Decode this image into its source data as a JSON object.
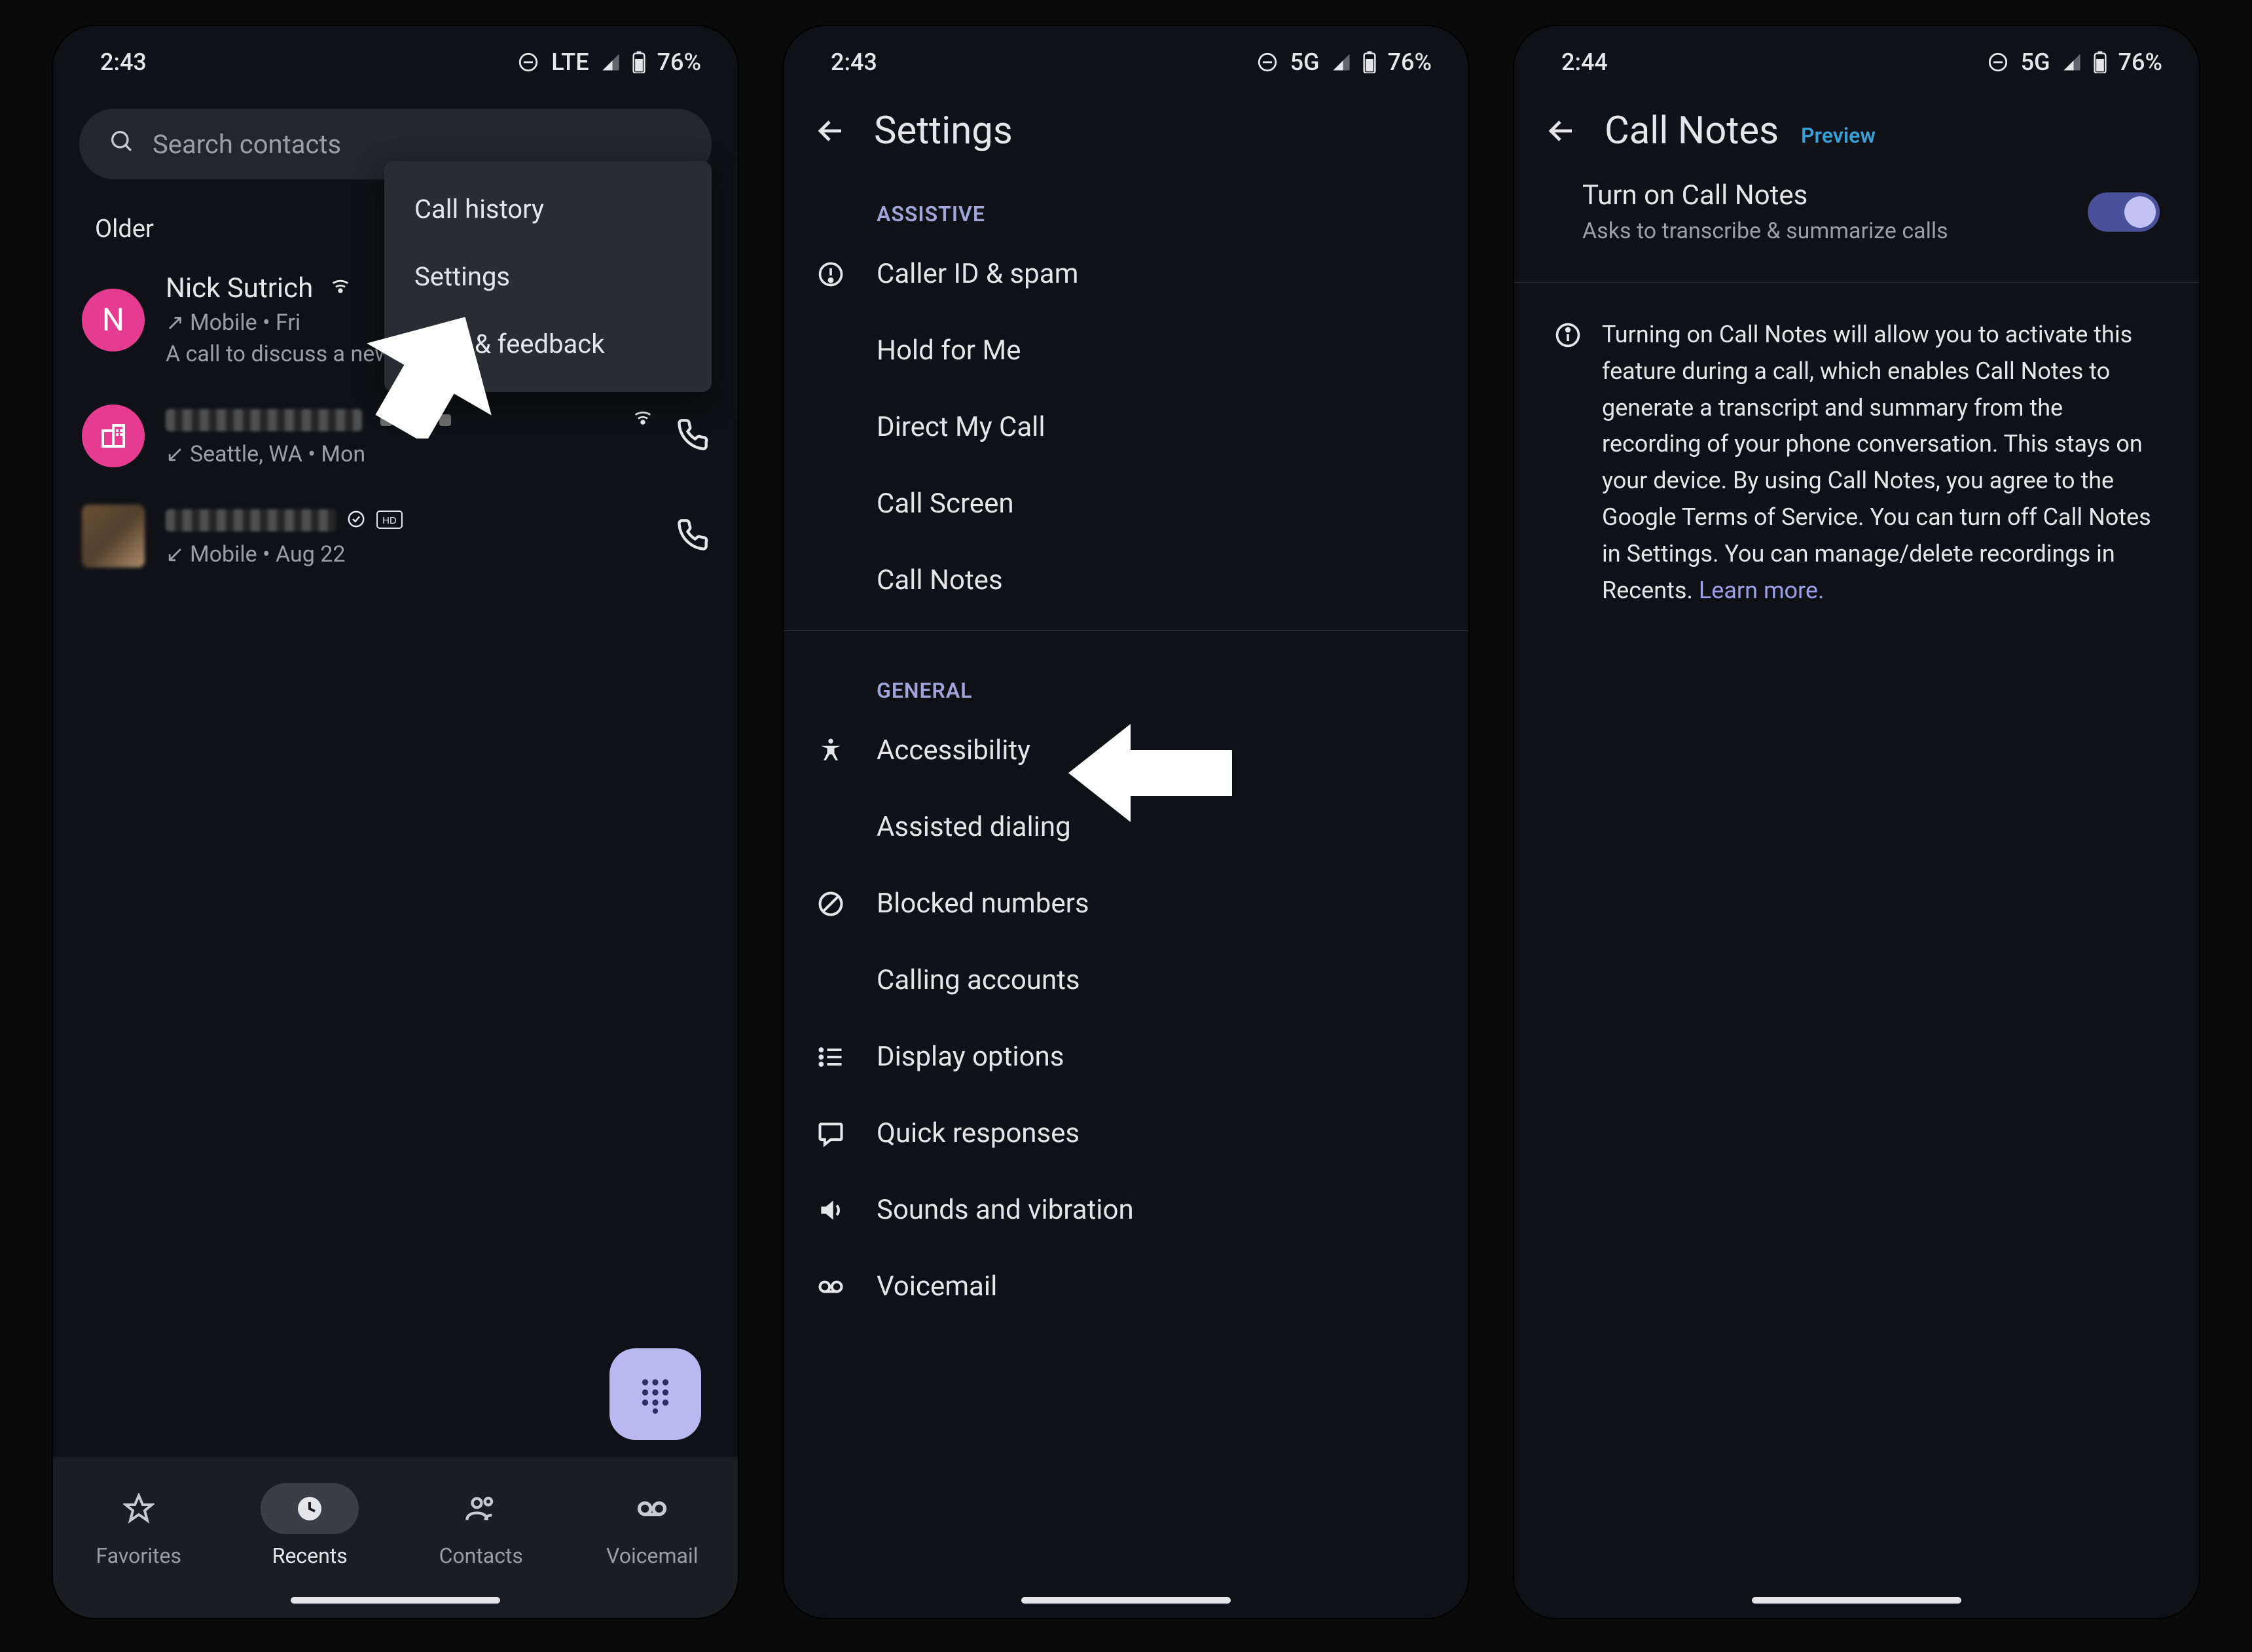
{
  "screen1": {
    "status": {
      "time": "2:43",
      "net": "LTE",
      "battery": "76%"
    },
    "search_placeholder": "Search contacts",
    "menu": {
      "items": [
        "Call history",
        "Settings",
        "Help & feedback"
      ]
    },
    "older_label": "Older",
    "calls": [
      {
        "avatar_letter": "N",
        "name": "Nick Sutrich",
        "meta": "Mobile • Fri",
        "note": "A call to discuss a new foldable phone, th…",
        "has_wifi": true
      },
      {
        "avatar_building": true,
        "name_redacted": true,
        "meta": "Seattle, WA • Mon",
        "has_wifi": true,
        "has_call_button": true
      },
      {
        "avatar_blur": true,
        "name_redacted": true,
        "meta": "Mobile • Aug 22",
        "has_badges": true,
        "has_call_button": true
      }
    ],
    "bottom": {
      "favorites": "Favorites",
      "recents": "Recents",
      "contacts": "Contacts",
      "voicemail": "Voicemail"
    }
  },
  "screen2": {
    "status": {
      "time": "2:43",
      "net": "5G",
      "battery": "76%"
    },
    "title": "Settings",
    "section_assistive": "ASSISTIVE",
    "assistive": [
      "Caller ID & spam",
      "Hold for Me",
      "Direct My Call",
      "Call Screen",
      "Call Notes"
    ],
    "section_general": "GENERAL",
    "general": [
      "Accessibility",
      "Assisted dialing",
      "Blocked numbers",
      "Calling accounts",
      "Display options",
      "Quick responses",
      "Sounds and vibration",
      "Voicemail"
    ]
  },
  "screen3": {
    "status": {
      "time": "2:44",
      "net": "5G",
      "battery": "76%"
    },
    "title": "Call Notes",
    "title_suffix": "Preview",
    "toggle": {
      "title": "Turn on Call Notes",
      "subtitle": "Asks to transcribe & summarize calls"
    },
    "info_text": "Turning on Call Notes will allow you to activate this feature during a call, which enables Call Notes to generate a transcript and summary from the recording of your phone conversation. This stays on your device. By using Call Notes, you agree to the Google Terms of Service. You can turn off Call Notes in Settings. You can manage/delete recordings in Recents. ",
    "learn_more": "Learn more."
  }
}
